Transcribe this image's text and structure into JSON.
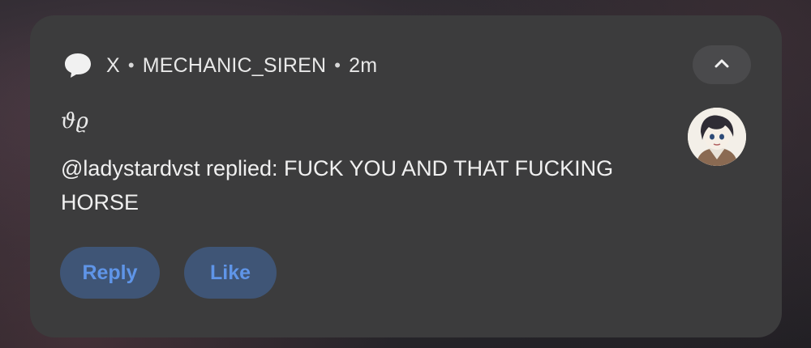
{
  "notification": {
    "app_name": "X",
    "separator": "•",
    "account": "MECHANIC_SIREN",
    "time": "2m",
    "title": "ϑϱ",
    "message": "@ladystardvst replied: FUCK YOU AND THAT FUCKING HORSE",
    "icons": {
      "app": "chat-bubble-icon",
      "collapse": "chevron-up-icon",
      "avatar": "profile-avatar"
    },
    "actions": {
      "reply_label": "Reply",
      "like_label": "Like"
    },
    "colors": {
      "card_bg": "#3c3c3d",
      "button_bg": "#3f5576",
      "button_text": "#5f95e8",
      "text": "#f0f0f0"
    }
  }
}
